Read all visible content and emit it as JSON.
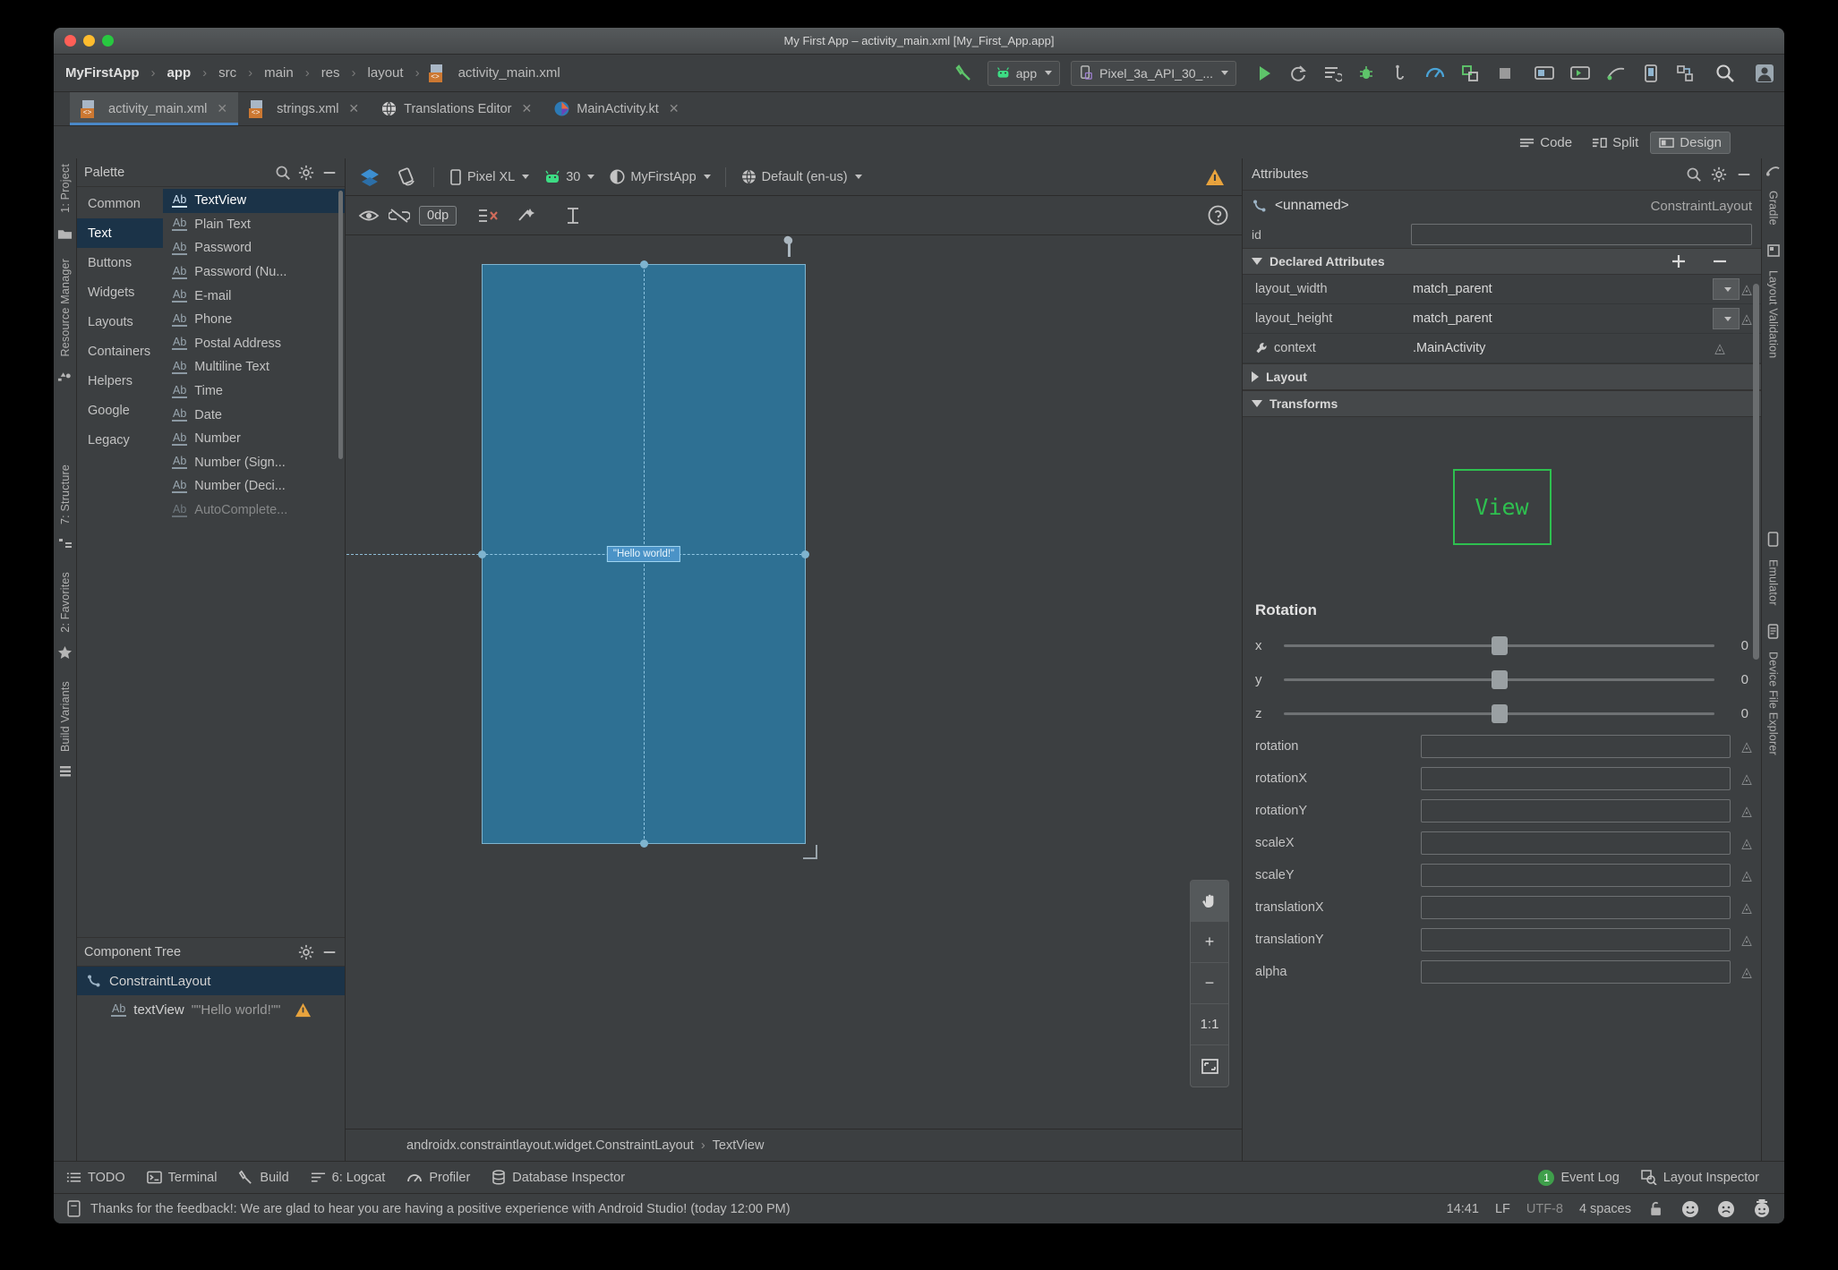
{
  "window": {
    "title": "My First App – activity_main.xml [My_First_App.app]",
    "traffic": [
      "close",
      "minimize",
      "zoom"
    ]
  },
  "breadcrumb": {
    "items": [
      "MyFirstApp",
      "app",
      "src",
      "main",
      "res",
      "layout"
    ],
    "file": "activity_main.xml",
    "separator": "›"
  },
  "toolbar": {
    "module_label": "app",
    "device_label": "Pixel_3a_API_30_...",
    "run_icon": "run-icon",
    "rerun_icon": "rerun-icon",
    "apply_changes_icon": "apply-changes-icon",
    "debug_icon": "debug-icon",
    "attach_debugger_icon": "attach-debugger-icon",
    "profiler_icon": "profiler-icon",
    "layout_inspector_icon": "layout-inspector-icon",
    "stop_icon": "stop-icon",
    "avd_manager_icon": "avd-manager-icon",
    "sdk_manager_icon": "sdk-manager-icon",
    "search_icon": "search-icon",
    "avatar_icon": "avatar-icon"
  },
  "tabs": [
    {
      "label": "activity_main.xml",
      "icon": "xml-file-icon",
      "active": true,
      "closable": true
    },
    {
      "label": "strings.xml",
      "icon": "xml-file-icon",
      "active": false,
      "closable": true
    },
    {
      "label": "Translations Editor",
      "icon": "globe-icon",
      "active": false,
      "closable": true
    },
    {
      "label": "MainActivity.kt",
      "icon": "kotlin-file-icon",
      "active": false,
      "closable": true
    }
  ],
  "editor_modes": [
    {
      "label": "Code",
      "selected": false,
      "icon": "code-icon"
    },
    {
      "label": "Split",
      "selected": false,
      "icon": "split-icon"
    },
    {
      "label": "Design",
      "selected": true,
      "icon": "design-icon"
    }
  ],
  "left_rail": [
    {
      "label": "1: Project",
      "icon": "project-icon"
    },
    {
      "label": "Resource Manager",
      "icon": "resource-manager-icon"
    },
    {
      "label": "7: Structure",
      "icon": "structure-icon"
    },
    {
      "label": "2: Favorites",
      "icon": "favorites-icon"
    },
    {
      "label": "Build Variants",
      "icon": "build-variants-icon"
    }
  ],
  "right_rail": [
    {
      "label": "Gradle",
      "icon": "gradle-icon"
    },
    {
      "label": "Layout Validation",
      "icon": "layout-validation-icon"
    },
    {
      "label": "Emulator",
      "icon": "emulator-icon"
    },
    {
      "label": "Device File Explorer",
      "icon": "device-file-explorer-icon"
    }
  ],
  "palette": {
    "title": "Palette",
    "search_icon": "search-icon",
    "gear_icon": "gear-icon",
    "minimize_icon": "minimize-icon",
    "categories": [
      {
        "label": "Common",
        "selected": false
      },
      {
        "label": "Text",
        "selected": true
      },
      {
        "label": "Buttons",
        "selected": false
      },
      {
        "label": "Widgets",
        "selected": false
      },
      {
        "label": "Layouts",
        "selected": false
      },
      {
        "label": "Containers",
        "selected": false
      },
      {
        "label": "Helpers",
        "selected": false
      },
      {
        "label": "Google",
        "selected": false
      },
      {
        "label": "Legacy",
        "selected": false
      }
    ],
    "items": [
      {
        "label": "TextView",
        "selected": true
      },
      {
        "label": "Plain Text",
        "selected": false
      },
      {
        "label": "Password",
        "selected": false
      },
      {
        "label": "Password (Nu...",
        "selected": false
      },
      {
        "label": "E-mail",
        "selected": false
      },
      {
        "label": "Phone",
        "selected": false
      },
      {
        "label": "Postal Address",
        "selected": false
      },
      {
        "label": "Multiline Text",
        "selected": false
      },
      {
        "label": "Time",
        "selected": false
      },
      {
        "label": "Date",
        "selected": false
      },
      {
        "label": "Number",
        "selected": false
      },
      {
        "label": "Number (Sign...",
        "selected": false
      },
      {
        "label": "Number (Deci...",
        "selected": false
      },
      {
        "label": "AutoComplete...",
        "selected": false
      }
    ],
    "item_icon_text": "Ab"
  },
  "component_tree": {
    "title": "Component Tree",
    "gear_icon": "gear-icon",
    "minimize_icon": "minimize-icon",
    "nodes": [
      {
        "label": "ConstraintLayout",
        "value": "",
        "selected": true,
        "icon": "constraint-layout-icon",
        "warning": false
      },
      {
        "label": "textView",
        "value": "\"\"Hello world!\"\"",
        "selected": false,
        "icon": "textview-icon",
        "warning": true
      }
    ]
  },
  "design_toolbar": {
    "layers_icon": "layers-icon",
    "orientation_icon": "rotate-orientation-icon",
    "device": "Pixel XL",
    "api_level": "30",
    "theme": "MyFirstApp",
    "locale": "Default (en-us)",
    "warning_icon": "warning-icon",
    "device_icon": "device-icon",
    "android_icon": "android-icon",
    "theme_icon": "theme-icon",
    "globe_icon": "globe-icon"
  },
  "constraint_toolbar": {
    "show_constraints_icon": "eye-icon",
    "autoconnect_icon": "autoconnect-off-icon",
    "default_margin": "0dp",
    "clear_constraints_icon": "clear-constraints-icon",
    "infer_constraints_icon": "infer-constraints-icon",
    "guidelines_icon": "guidelines-icon",
    "help_icon": "help-icon"
  },
  "canvas": {
    "hello_world_text": "\"Hello world!\"",
    "wrench_icon": "design-surface-wrench-icon",
    "tools": [
      {
        "icon": "pan-hand-icon",
        "label": "",
        "active": true
      },
      {
        "icon": "zoom-in-icon",
        "label": "+",
        "active": false
      },
      {
        "icon": "zoom-out-icon",
        "label": "−",
        "active": false
      },
      {
        "icon": "zoom-actual-icon",
        "label": "1:1",
        "active": false
      },
      {
        "icon": "zoom-to-fit-icon",
        "label": "",
        "active": false
      }
    ]
  },
  "canvas_breadcrumb": {
    "root": "androidx.constraintlayout.widget.ConstraintLayout",
    "separator": "›",
    "child": "TextView"
  },
  "attributes": {
    "title": "Attributes",
    "search_icon": "search-icon",
    "gear_icon": "gear-icon",
    "minimize_icon": "minimize-icon",
    "selected_name": "<unnamed>",
    "selected_type": "ConstraintLayout",
    "id_label": "id",
    "id_value": "",
    "sections": {
      "declared": {
        "label": "Declared Attributes",
        "expanded": true,
        "add_icon": "plus-icon",
        "remove_icon": "minus-icon"
      },
      "layout": {
        "label": "Layout",
        "expanded": false
      },
      "transforms": {
        "label": "Transforms",
        "expanded": true
      }
    },
    "declared_rows": [
      {
        "key": "layout_width",
        "value": "match_parent",
        "dropdown": true,
        "icon": ""
      },
      {
        "key": "layout_height",
        "value": "match_parent",
        "dropdown": true,
        "icon": ""
      },
      {
        "key": "context",
        "value": ".MainActivity",
        "dropdown": false,
        "icon": "wrench-icon"
      }
    ],
    "transform_preview_label": "View",
    "rotation_label": "Rotation",
    "rotation_sliders": [
      {
        "axis": "x",
        "value": "0"
      },
      {
        "axis": "y",
        "value": "0"
      },
      {
        "axis": "z",
        "value": "0"
      }
    ],
    "fields": [
      {
        "key": "rotation",
        "value": ""
      },
      {
        "key": "rotationX",
        "value": ""
      },
      {
        "key": "rotationY",
        "value": ""
      },
      {
        "key": "scaleX",
        "value": ""
      },
      {
        "key": "scaleY",
        "value": ""
      },
      {
        "key": "translationX",
        "value": ""
      },
      {
        "key": "translationY",
        "value": ""
      },
      {
        "key": "alpha",
        "value": ""
      }
    ]
  },
  "bottom_bar": {
    "left_items": [
      {
        "label": "TODO",
        "icon": "todo-icon"
      },
      {
        "label": "Terminal",
        "icon": "terminal-icon"
      },
      {
        "label": "Build",
        "icon": "build-icon"
      },
      {
        "label": "6: Logcat",
        "icon": "logcat-icon"
      },
      {
        "label": "Profiler",
        "icon": "profiler-icon"
      },
      {
        "label": "Database Inspector",
        "icon": "database-icon"
      }
    ],
    "right_items": [
      {
        "label": "Event Log",
        "icon": "event-log-icon",
        "badge": "1"
      },
      {
        "label": "Layout Inspector",
        "icon": "layout-inspector-icon",
        "badge": ""
      }
    ]
  },
  "status_bar": {
    "message": "Thanks for the feedback!: We are glad to hear you are having a positive experience with Android Studio! (today 12:00 PM)",
    "message_icon": "notification-icon",
    "time": "14:41",
    "line_separator": "LF",
    "encoding": "UTF-8",
    "indent": "4 spaces",
    "lock_icon": "unlock-icon",
    "happy_icon": "happy-face-icon",
    "sad_icon": "sad-face-icon",
    "wizard_icon": "wizard-face-icon"
  },
  "colors": {
    "accent_blue": "#4a88c7",
    "selection_blue": "#1b3348",
    "panel_bg": "#3c3f41",
    "device_blue": "#2e7093",
    "green_view": "#2ec04f",
    "orange_xml": "#cc7832",
    "warning_yellow": "#e8a33d"
  }
}
